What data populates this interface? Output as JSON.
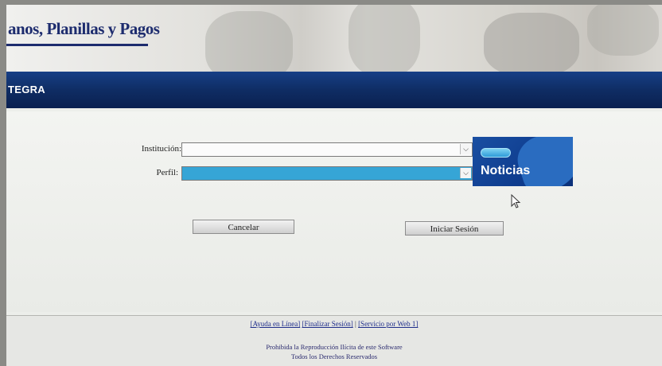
{
  "header": {
    "title": "anos, Planillas y Pagos",
    "nav_title": "TEGRA"
  },
  "form": {
    "institucion_label": "Institución:",
    "institucion_value": "",
    "perfil_label": "Perfil:",
    "perfil_value": ""
  },
  "noticias": {
    "label": "Noticias"
  },
  "buttons": {
    "cancel_label": "Cancelar",
    "start_label": "Iniciar Sesión"
  },
  "footer": {
    "help_link": "[Ayuda en Línea]",
    "logout_link": "[Finalizar Sesión]",
    "separator": "|",
    "web_service_link": "[Servicio por Web 1]",
    "notice_line1": "Prohibida la Reproducción Ilícita de este Software",
    "notice_line2": "Todos los Derechos Reservados"
  },
  "icons": {
    "select_arrow": "chevron-down-icon",
    "cursor": "mouse-pointer-icon"
  },
  "colors": {
    "header_blue": "#1d2c6e",
    "navbar_blue": "#0f2d64",
    "selected_field": "#36a5d6",
    "noticias_bg": "#0e3c8e"
  }
}
